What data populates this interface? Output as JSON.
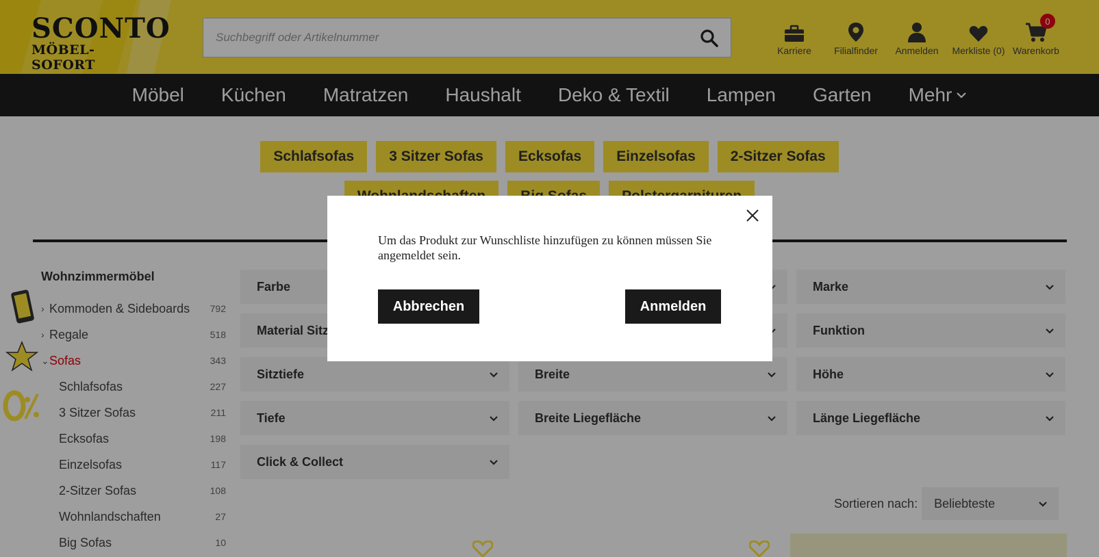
{
  "header": {
    "logo": {
      "line1": "SCONTO",
      "line2": "MÖBEL-SOFORT"
    },
    "search": {
      "placeholder": "Suchbegriff oder Artikelnummer",
      "value": ""
    },
    "actions": [
      {
        "label": "Karriere",
        "icon": "briefcase-icon"
      },
      {
        "label": "Filialfinder",
        "icon": "map-pin-icon"
      },
      {
        "label": "Anmelden",
        "icon": "user-icon"
      },
      {
        "label": "Merkliste (0)",
        "icon": "heart-icon"
      },
      {
        "label": "Warenkorb",
        "icon": "cart-icon",
        "badge": "0"
      }
    ]
  },
  "nav": {
    "items": [
      "Möbel",
      "Küchen",
      "Matratzen",
      "Haushalt",
      "Deko & Textil",
      "Lampen",
      "Garten",
      "Mehr"
    ]
  },
  "chips": [
    "Schlafsofas",
    "3 Sitzer Sofas",
    "Ecksofas",
    "Einzelsofas",
    "2-Sitzer Sofas",
    "Wohnlandschaften",
    "Big Sofas",
    "Polstergarnituren"
  ],
  "sidebar": {
    "title": "Wohnzimmermöbel",
    "items": [
      {
        "label": "Kommoden & Sideboards",
        "count": "792"
      },
      {
        "label": "Regale",
        "count": "518"
      },
      {
        "label": "Sofas",
        "count": "343"
      }
    ],
    "subitems": [
      {
        "label": "Schlafsofas",
        "count": "227"
      },
      {
        "label": "3 Sitzer Sofas",
        "count": "211"
      },
      {
        "label": "Ecksofas",
        "count": "198"
      },
      {
        "label": "Einzelsofas",
        "count": "117"
      },
      {
        "label": "2-Sitzer Sofas",
        "count": "108"
      },
      {
        "label": "Wohnlandschaften",
        "count": "27"
      },
      {
        "label": "Big Sofas",
        "count": "10"
      }
    ]
  },
  "filters": [
    "Farbe",
    "",
    "Marke",
    "Material Sitz",
    "",
    "Funktion",
    "Sitztiefe",
    "Breite",
    "Höhe",
    "Tiefe",
    "Breite Liegefläche",
    "Länge Liegefläche",
    "Click & Collect"
  ],
  "sort": {
    "label": "Sortieren nach:",
    "value": "Beliebteste"
  },
  "modal": {
    "message": "Um das Produkt zur Wunschliste hinzufügen zu können müssen Sie angemeldet sein.",
    "cancel": "Abbrechen",
    "login": "Anmelden"
  },
  "colors": {
    "brand_yellow": "#fde23a",
    "nav_dark": "#1e1e1e",
    "accent_red": "#e30613"
  }
}
